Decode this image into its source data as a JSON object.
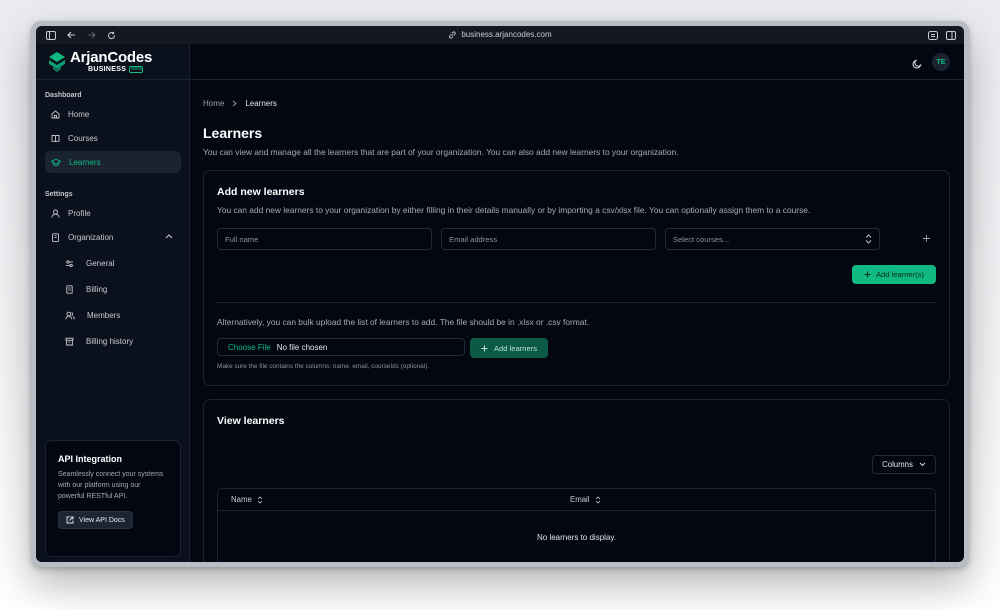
{
  "browser": {
    "url": "business.arjancodes.com"
  },
  "brand": {
    "name": "ArjanCodes",
    "sub": "BUSINESS",
    "badge": "Beta",
    "accent": "#10b981"
  },
  "sidebar": {
    "dashboard_title": "Dashboard",
    "settings_title": "Settings",
    "items": [
      {
        "label": "Home",
        "icon": "home-icon"
      },
      {
        "label": "Courses",
        "icon": "book-icon"
      },
      {
        "label": "Learners",
        "icon": "graduation-cap-icon",
        "active": true
      }
    ],
    "settings_items": [
      {
        "label": "Profile",
        "icon": "user-icon"
      },
      {
        "label": "Organization",
        "icon": "building-icon",
        "expanded": true
      }
    ],
    "org_items": [
      {
        "label": "General",
        "icon": "sliders-icon"
      },
      {
        "label": "Billing",
        "icon": "receipt-icon"
      },
      {
        "label": "Members",
        "icon": "users-icon"
      },
      {
        "label": "Billing history",
        "icon": "archive-icon"
      }
    ],
    "api": {
      "title": "API Integration",
      "desc": "Seamlessly connect your systems with our platform using our powerful RESTful API.",
      "button": "View API Docs"
    }
  },
  "topbar": {
    "avatar": "TE"
  },
  "breadcrumb": {
    "home": "Home",
    "current": "Learners"
  },
  "page": {
    "title": "Learners",
    "desc": "You can view and manage all the learners that are part of your organization. You can also add new learners to your organization."
  },
  "add_card": {
    "title": "Add new learners",
    "desc": "You can add new learners to your organization by either filling in their details manually or by importing a csv/xlsx file. You can optionally assign them to a course.",
    "name_placeholder": "Full name",
    "email_placeholder": "Email address",
    "courses_placeholder": "Select courses...",
    "add_button": "Add learner(s)",
    "alt_text": "Alternatively, you can bulk upload the list of learners to add. The file should be in .xlsx or .csv format.",
    "choose_file": "Choose File",
    "no_file": "No file chosen",
    "bulk_button": "Add learners",
    "hint": "Make sure the file contains the columns: name, email, courseIds (optional)."
  },
  "view_card": {
    "title": "View learners",
    "columns_button": "Columns",
    "headers": [
      "Name",
      "Email"
    ],
    "empty": "No learners to display."
  }
}
